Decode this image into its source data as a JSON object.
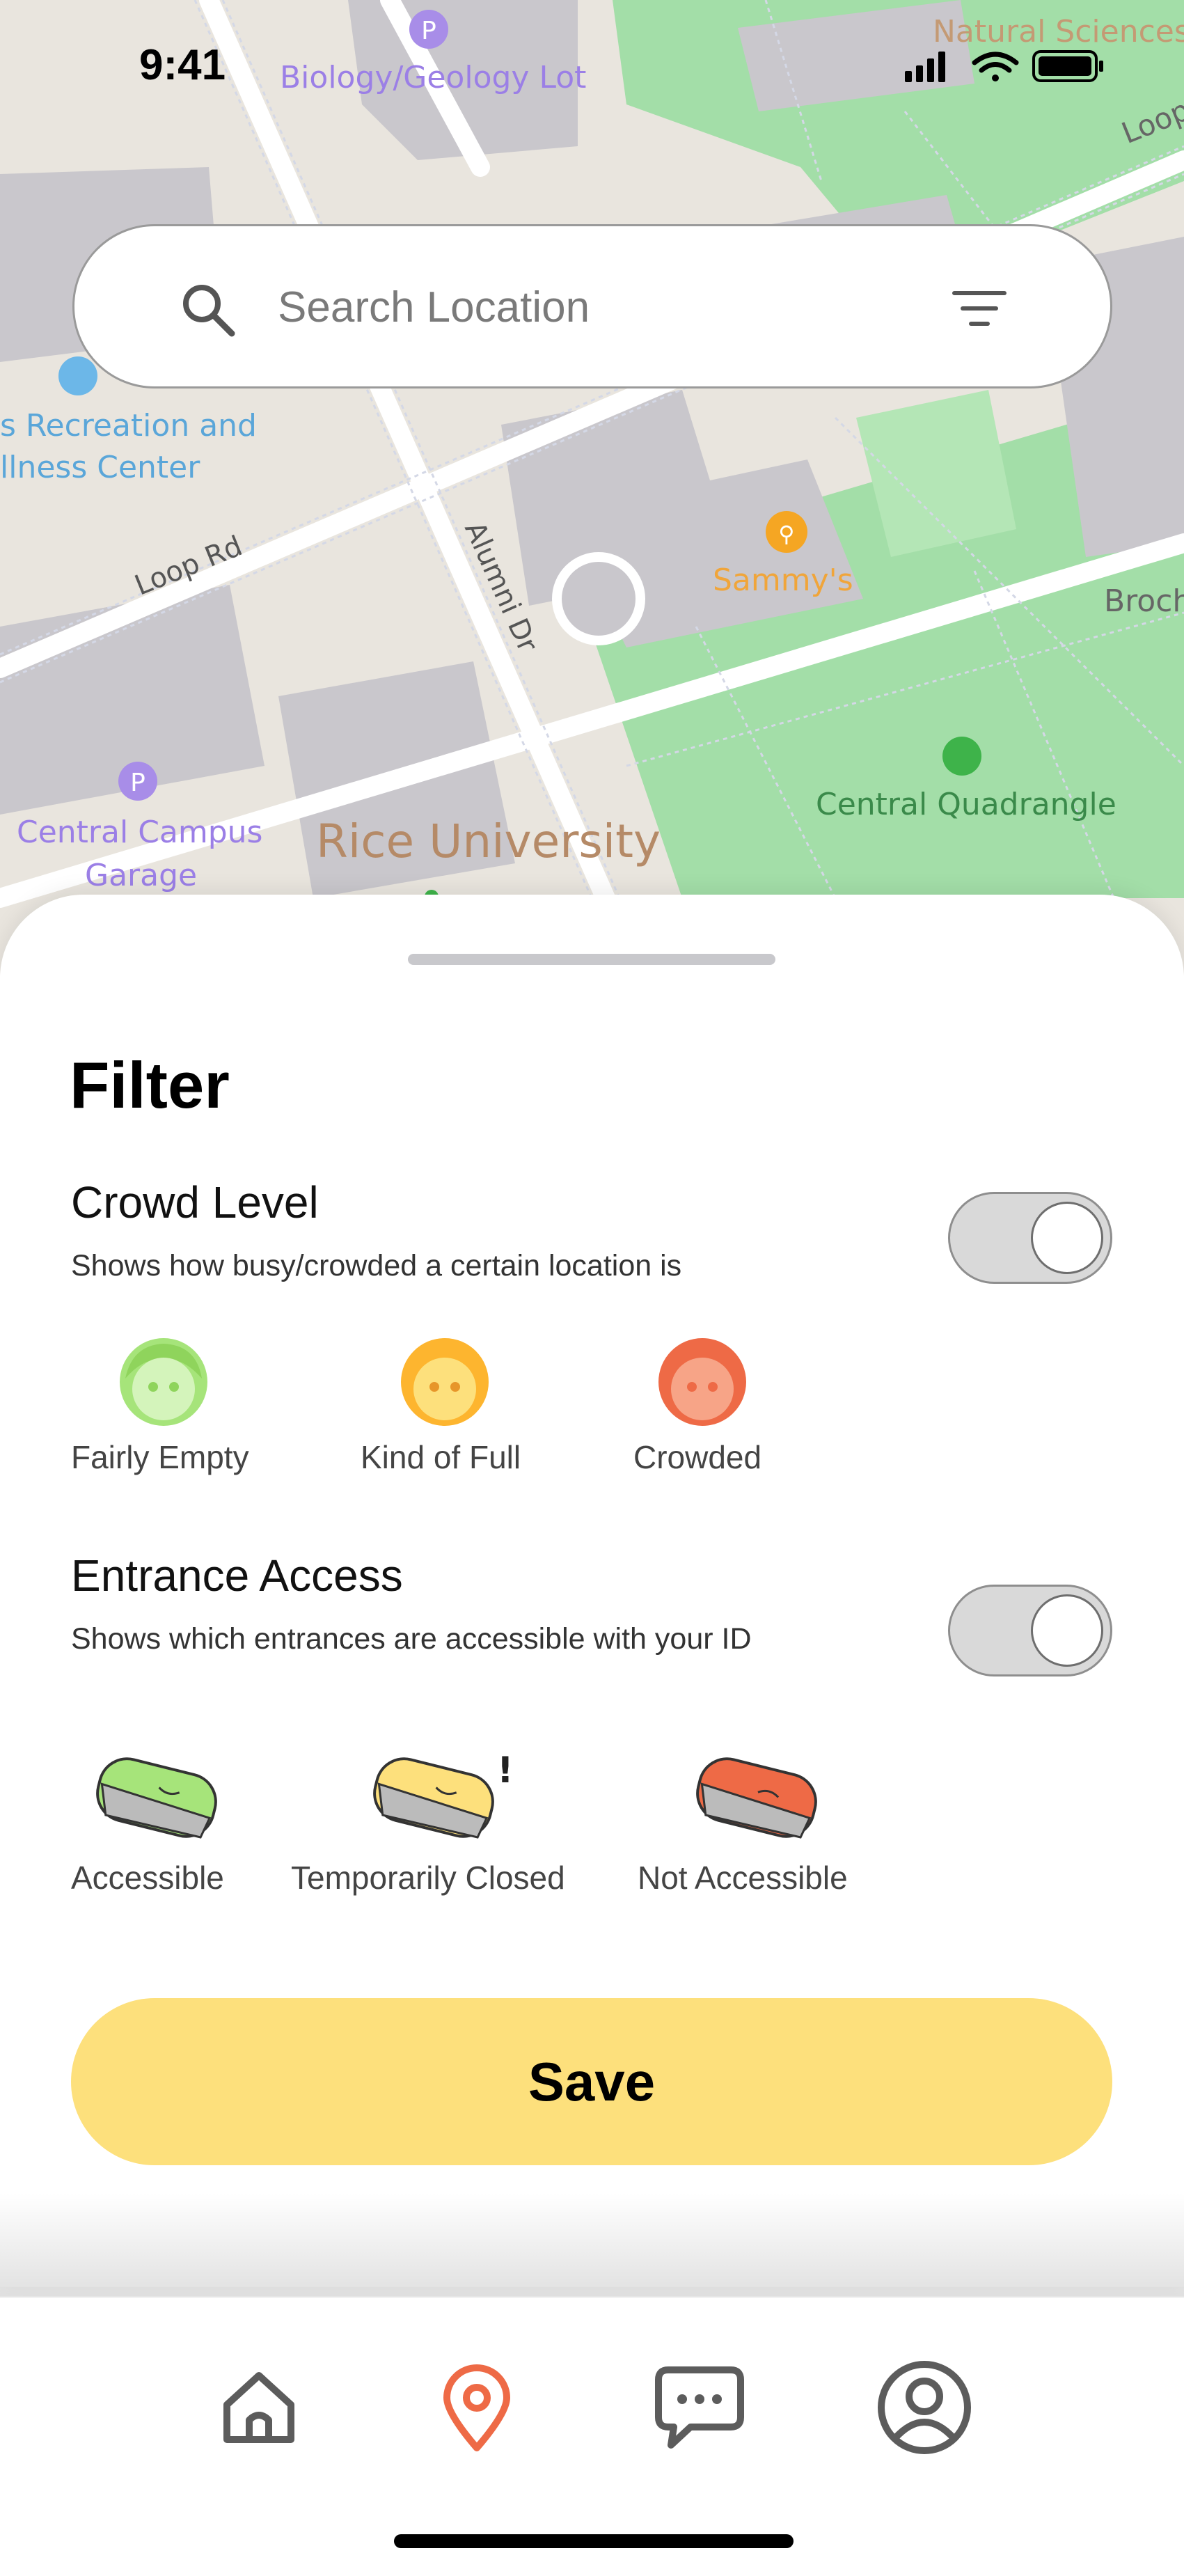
{
  "status_bar": {
    "time": "9:41"
  },
  "map": {
    "labels": {
      "biology_geology_lot": "Biology/Geology Lot",
      "natural_sciences": "Natural Sciences",
      "loop_right": "Loop",
      "recreation_center_line1": "s Recreation and",
      "recreation_center_line2": "llness Center",
      "loop_rd": "Loop Rd",
      "alumni_dr": "Alumni Dr",
      "sammys": "Sammy's",
      "broch": "Broch",
      "central_campus_garage_line1": "Central Campus",
      "central_campus_garage_line2": "Garage",
      "rice_university": "Rice University",
      "central_quadrangle": "Central Quadrangle"
    }
  },
  "search": {
    "placeholder": "Search Location"
  },
  "filter": {
    "title": "Filter",
    "crowd_level": {
      "title": "Crowd Level",
      "description": "Shows how busy/crowded a certain location is",
      "enabled": true,
      "legend": [
        {
          "label": "Fairly Empty",
          "color": "#a6e47a"
        },
        {
          "label": "Kind of Full",
          "color": "#fdb52f"
        },
        {
          "label": "Crowded",
          "color": "#ee6a46"
        }
      ]
    },
    "entrance_access": {
      "title": "Entrance Access",
      "description": "Shows which entrances are accessible with your ID",
      "enabled": true,
      "legend": [
        {
          "label": "Accessible",
          "color": "#a6e47a"
        },
        {
          "label": "Temporarily Closed",
          "color": "#fde07c"
        },
        {
          "label": "Not Accessible",
          "color": "#ee6a46"
        }
      ]
    },
    "save_label": "Save"
  },
  "tab_bar": {
    "items": [
      {
        "icon": "home-icon",
        "active": false
      },
      {
        "icon": "map-pin-icon",
        "active": true
      },
      {
        "icon": "chat-icon",
        "active": false
      },
      {
        "icon": "profile-icon",
        "active": false
      }
    ],
    "active_color": "#ee6a46",
    "inactive_color": "#5c5c5c"
  }
}
